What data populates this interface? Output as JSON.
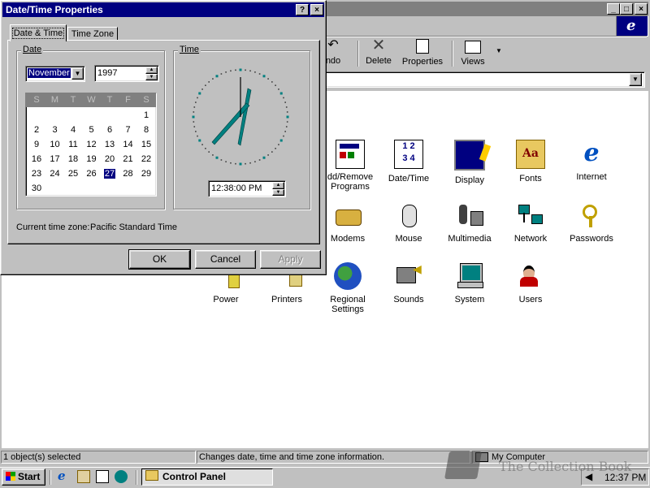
{
  "explorer": {
    "title_buttons": [
      "_",
      "□",
      "×"
    ],
    "toolbar": [
      {
        "label": "Undo",
        "visible": "ndo"
      },
      {
        "label": "Delete"
      },
      {
        "label": "Properties"
      },
      {
        "label": "Views"
      }
    ],
    "icons_row1": [
      "Add/Remove Programs",
      "Date/Time",
      "Display",
      "Fonts",
      "Internet"
    ],
    "icons_row1_visible": [
      "dd/Remove",
      "Programs"
    ],
    "icons_row2": [
      "Modems",
      "Mouse",
      "Multimedia",
      "Network",
      "Passwords"
    ],
    "icons_row3": [
      "Power",
      "Printers",
      "Regional Settings",
      "Sounds",
      "System",
      "Users"
    ],
    "regional": [
      "Regional",
      "Settings"
    ],
    "status_left": "1 object(s) selected",
    "status_mid": "Changes date, time and time zone information.",
    "status_right": "My Computer"
  },
  "dialog": {
    "title": "Date/Time Properties",
    "tabs": [
      "Date & Time",
      "Time Zone"
    ],
    "date_group": "Date",
    "time_group": "Time",
    "month": "November",
    "year": "1997",
    "weekdays": [
      "S",
      "M",
      "T",
      "W",
      "T",
      "F",
      "S"
    ],
    "selected_day": "27",
    "time_value": "12:38:00 PM",
    "timezone_label": "Current time zone:",
    "timezone_value": "Pacific Standard Time",
    "ok": "OK",
    "cancel": "Cancel",
    "apply": "Apply"
  },
  "taskbar": {
    "start": "Start",
    "task": "Control Panel",
    "clock": "12:37 PM"
  },
  "watermark": "The Collection Book",
  "colors": {
    "titlebar": "#000080",
    "face": "#c0c0c0",
    "desktop_bg": "#ffffff",
    "accent": "#008080"
  }
}
